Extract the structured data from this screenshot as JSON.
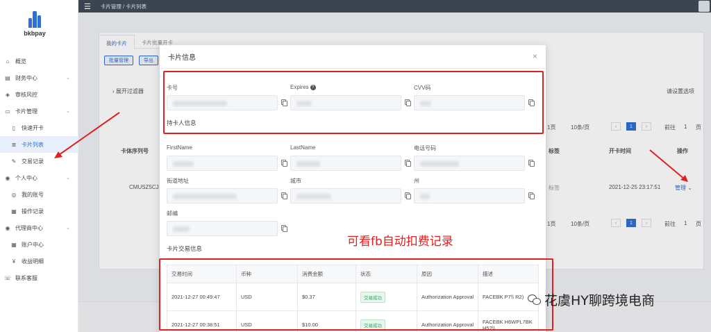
{
  "brand": {
    "name": "bkbpay"
  },
  "topbar": {
    "breadcrumb": "卡片管理 / 卡片列表"
  },
  "sidebar": {
    "items": [
      {
        "label": "概览",
        "icon": "home-icon",
        "sub": false,
        "active": false
      },
      {
        "label": "财务中心",
        "icon": "wallet-icon",
        "sub": false,
        "active": false,
        "chevron": true
      },
      {
        "label": "审核风控",
        "icon": "shield-icon",
        "sub": false,
        "active": false
      },
      {
        "label": "卡片管理",
        "icon": "card-icon",
        "sub": false,
        "active": false,
        "chevron": true
      },
      {
        "label": "快速开卡",
        "icon": "doc-icon",
        "sub": true,
        "active": false
      },
      {
        "label": "卡片列表",
        "icon": "list-icon",
        "sub": true,
        "active": true
      },
      {
        "label": "交易记录",
        "icon": "edit-icon",
        "sub": true,
        "active": false
      },
      {
        "label": "个人中心",
        "icon": "user-icon",
        "sub": false,
        "active": false,
        "chevron": true
      },
      {
        "label": "我的账号",
        "icon": "account-icon",
        "sub": true,
        "active": false
      },
      {
        "label": "操作记录",
        "icon": "log-icon",
        "sub": true,
        "active": false
      },
      {
        "label": "代理商中心",
        "icon": "agent-icon",
        "sub": false,
        "active": false,
        "chevron": true
      },
      {
        "label": "账户中心",
        "icon": "grid-icon",
        "sub": true,
        "active": false
      },
      {
        "label": "收益明细",
        "icon": "money-icon",
        "sub": true,
        "active": false
      },
      {
        "label": "联系客服",
        "icon": "phone-icon",
        "sub": false,
        "active": false
      }
    ]
  },
  "background": {
    "tabs": [
      "我的卡片",
      "卡片批量开卡"
    ],
    "buttons": [
      "批量管理",
      "导出"
    ],
    "filter_label": "展开过滤器",
    "filter_right": "请设置选项",
    "table_headers": {
      "card_no": "卡体序列号",
      "remark": "标签",
      "open_time": "开卡时间",
      "action": "操作"
    },
    "row": {
      "card_no": "CMUSZ5CJ",
      "tag": "标签",
      "open_time": "2021-12-25 23:17:51",
      "action": "管理"
    },
    "pager": {
      "per_page": "10条/页",
      "total": "1页",
      "goto": "前往",
      "page": "1",
      "page_suffix": "页"
    }
  },
  "modal": {
    "title": "卡片信息",
    "close": "×",
    "card": {
      "card_no_label": "卡号",
      "expires_label": "Expires",
      "cvv_label": "CVV码"
    },
    "holder_title": "持卡人信息",
    "holder": {
      "first_name_label": "FirstName",
      "last_name_label": "LastName",
      "phone_label": "电话号码",
      "street_label": "街道地址",
      "city_label": "城市",
      "state_label": "州",
      "zip_label": "邮编"
    },
    "tx_title": "卡片交易信息",
    "tx_headers": [
      "交易时间",
      "币种",
      "消费金额",
      "状态",
      "原因",
      "描述"
    ],
    "tx_rows": [
      {
        "time": "2021-12-27 00:49:47",
        "currency": "USD",
        "amount": "$0.37",
        "status": "交易成功",
        "reason": "Authorization Approval",
        "desc": "FACEBK P7\\\\ R2)"
      },
      {
        "time": "2021-12-27 00:38:51",
        "currency": "USD",
        "amount": "$10.00",
        "status": "交易成功",
        "reason": "Authorization Approval",
        "desc": "FACEBK H6WPL7BK H52\\\\"
      }
    ]
  },
  "annotation": {
    "text": "可看fb自动扣费记录"
  },
  "watermark": {
    "text": "花虞HY聊跨境电商"
  },
  "colors": {
    "accent": "#2f6fd6",
    "annotation": "#e02020",
    "topbar": "#3b4552"
  }
}
